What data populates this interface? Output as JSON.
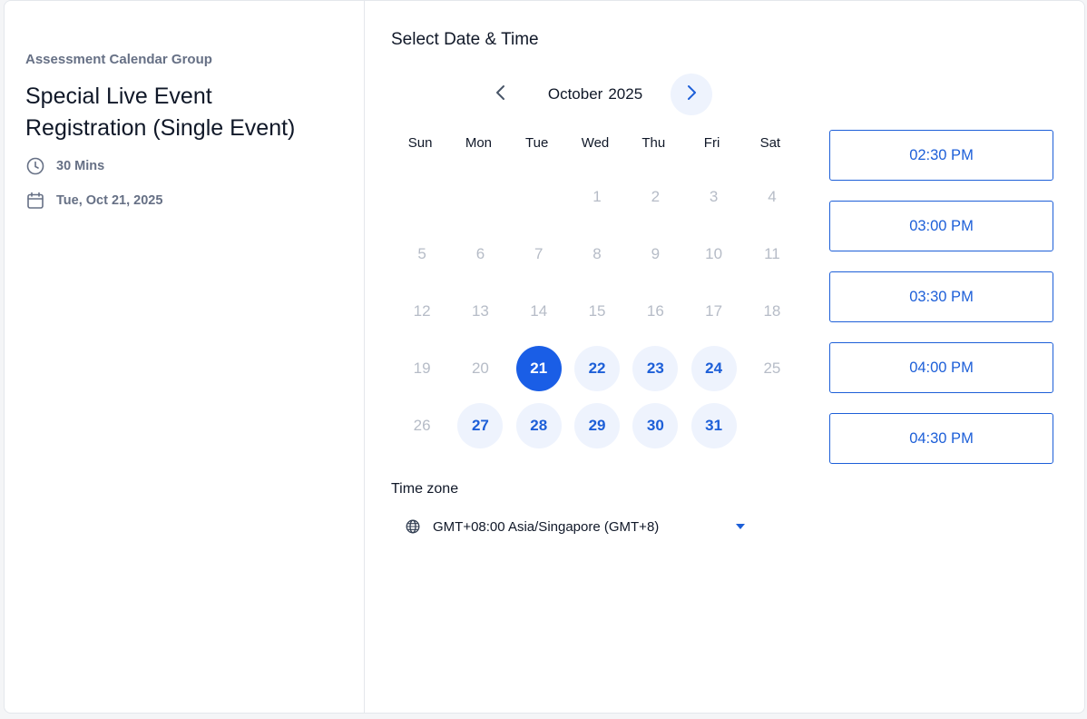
{
  "event": {
    "group_name": "Assessment Calendar Group",
    "title": "Special Live Event Registration (Single Event)",
    "duration": "30 Mins",
    "date": "Tue, Oct 21, 2025",
    "duration_icon": "clock-icon",
    "date_icon": "calendar-icon"
  },
  "scheduler": {
    "title": "Select Date & Time",
    "month": "October",
    "year": "2025",
    "weekdays": [
      "Sun",
      "Mon",
      "Tue",
      "Wed",
      "Thu",
      "Fri",
      "Sat"
    ],
    "days": [
      {
        "label": "",
        "state": "empty"
      },
      {
        "label": "",
        "state": "empty"
      },
      {
        "label": "",
        "state": "empty"
      },
      {
        "label": "1",
        "state": "disabled"
      },
      {
        "label": "2",
        "state": "disabled"
      },
      {
        "label": "3",
        "state": "disabled"
      },
      {
        "label": "4",
        "state": "disabled"
      },
      {
        "label": "5",
        "state": "disabled"
      },
      {
        "label": "6",
        "state": "disabled"
      },
      {
        "label": "7",
        "state": "disabled"
      },
      {
        "label": "8",
        "state": "disabled"
      },
      {
        "label": "9",
        "state": "disabled"
      },
      {
        "label": "10",
        "state": "disabled"
      },
      {
        "label": "11",
        "state": "disabled"
      },
      {
        "label": "12",
        "state": "disabled"
      },
      {
        "label": "13",
        "state": "disabled"
      },
      {
        "label": "14",
        "state": "disabled"
      },
      {
        "label": "15",
        "state": "disabled"
      },
      {
        "label": "16",
        "state": "disabled"
      },
      {
        "label": "17",
        "state": "disabled"
      },
      {
        "label": "18",
        "state": "disabled"
      },
      {
        "label": "19",
        "state": "disabled"
      },
      {
        "label": "20",
        "state": "disabled"
      },
      {
        "label": "21",
        "state": "selected"
      },
      {
        "label": "22",
        "state": "available"
      },
      {
        "label": "23",
        "state": "available"
      },
      {
        "label": "24",
        "state": "available"
      },
      {
        "label": "25",
        "state": "disabled"
      },
      {
        "label": "26",
        "state": "disabled"
      },
      {
        "label": "27",
        "state": "available"
      },
      {
        "label": "28",
        "state": "available"
      },
      {
        "label": "29",
        "state": "available"
      },
      {
        "label": "30",
        "state": "available"
      },
      {
        "label": "31",
        "state": "available"
      }
    ],
    "timezone_label": "Time zone",
    "timezone_value": "GMT+08:00 Asia/Singapore (GMT+8)",
    "time_slots": [
      "02:30 PM",
      "03:00 PM",
      "03:30 PM",
      "04:00 PM",
      "04:30 PM"
    ]
  },
  "colors": {
    "accent": "#1a5ee6",
    "available_bg": "#eef3fd",
    "disabled_text": "#b6bcc7"
  }
}
